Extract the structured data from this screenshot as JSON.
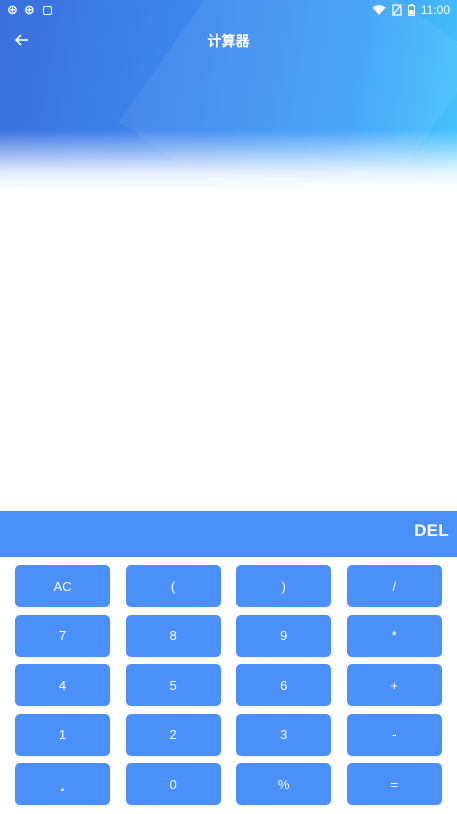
{
  "status_bar": {
    "time": "11:00",
    "left_icons": [
      "notification-glyph",
      "notification-glyph",
      "small-square"
    ]
  },
  "nav": {
    "title": "计算器",
    "back_icon": "arrow-left-icon"
  },
  "display": {
    "expression": "",
    "result": ""
  },
  "del_label": "DEL",
  "keys": [
    "AC",
    "(",
    ")",
    "/",
    "7",
    "8",
    "9",
    "*",
    "4",
    "5",
    "6",
    "+",
    "1",
    "2",
    "3",
    "-",
    ".",
    "0",
    "%",
    "="
  ],
  "colors": {
    "accent": "#4b8ff8",
    "header_start": "#3a6fdc",
    "header_end": "#45c6fb",
    "text_on_accent": "#ffffff"
  }
}
